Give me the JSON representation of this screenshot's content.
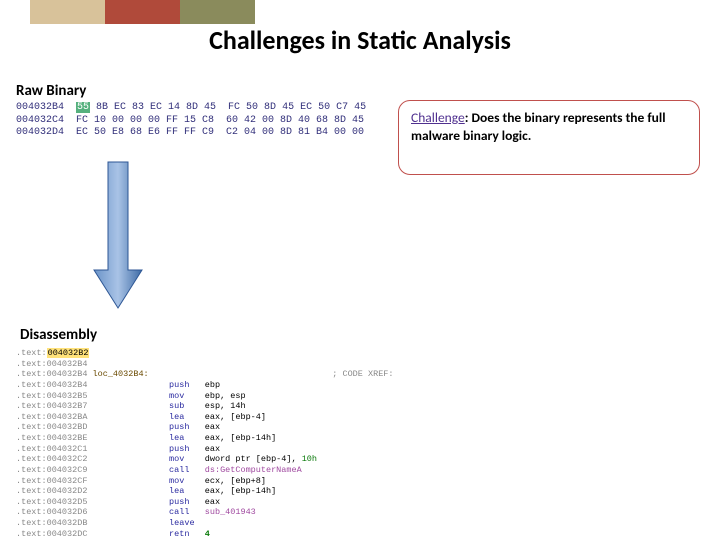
{
  "title": "Challenges in Static Analysis",
  "sections": {
    "raw_label": "Raw Binary",
    "dis_label": "Disassembly"
  },
  "challenge": {
    "label": "Challenge",
    "text": ": Does the binary represents the full malware binary logic."
  },
  "hex": {
    "lines": [
      {
        "addr": "004032B4",
        "hl": "55",
        "rest": " 8B EC 83 EC 14 8D 45  FC 50 8D 45 EC 50 C7 45"
      },
      {
        "addr": "004032C4",
        "hl": "",
        "rest": "FC 10 00 00 00 FF 15 C8  60 42 00 8D 40 68 8D 45"
      },
      {
        "addr": "004032D4",
        "hl": "",
        "rest": "EC 50 E8 68 E6 FF FF C9  C2 04 00 8D 81 B4 00 00"
      }
    ]
  },
  "disassembly": {
    "comment": "; CODE XREF:",
    "lines": [
      {
        "addr": ".text:004032B2",
        "op": "",
        "arg": ""
      },
      {
        "addr": ".text:004032B4",
        "op": "",
        "arg": ""
      },
      {
        "addr": ".text:004032B4",
        "label": "loc_4032B4:",
        "op": "",
        "arg": ""
      },
      {
        "addr": ".text:004032B4",
        "op": "push",
        "arg": "ebp"
      },
      {
        "addr": ".text:004032B5",
        "op": "mov",
        "arg": "ebp, esp"
      },
      {
        "addr": ".text:004032B7",
        "op": "sub",
        "arg": "esp, 14h"
      },
      {
        "addr": ".text:004032BA",
        "op": "lea",
        "arg": "eax, [ebp-4]"
      },
      {
        "addr": ".text:004032BD",
        "op": "push",
        "arg": "eax"
      },
      {
        "addr": ".text:004032BE",
        "op": "lea",
        "arg": "eax, [ebp-14h]"
      },
      {
        "addr": ".text:004032C1",
        "op": "push",
        "arg": "eax"
      },
      {
        "addr": ".text:004032C2",
        "op": "mov",
        "arg": "dword ptr [ebp-4], 10h",
        "num": "10h"
      },
      {
        "addr": ".text:004032C9",
        "op": "call",
        "arg": "ds:GetComputerNameA",
        "isCall": true
      },
      {
        "addr": ".text:004032CF",
        "op": "mov",
        "arg": "ecx, [ebp+8]"
      },
      {
        "addr": ".text:004032D2",
        "op": "lea",
        "arg": "eax, [ebp-14h]"
      },
      {
        "addr": ".text:004032D5",
        "op": "push",
        "arg": "eax"
      },
      {
        "addr": ".text:004032D6",
        "op": "call",
        "arg": "sub_401943",
        "isCall": true
      },
      {
        "addr": ".text:004032DB",
        "op": "leave",
        "arg": ""
      },
      {
        "addr": ".text:004032DC",
        "op": "retn",
        "arg": "4",
        "isNum": true
      }
    ]
  },
  "colors": {
    "tan": "#d8c29a",
    "red": "#b04a3a",
    "olive": "#8a8b5c",
    "challenge_border": "#c0504d",
    "challenge_word": "#4f2f8f",
    "arrow": "#4f81bd"
  }
}
